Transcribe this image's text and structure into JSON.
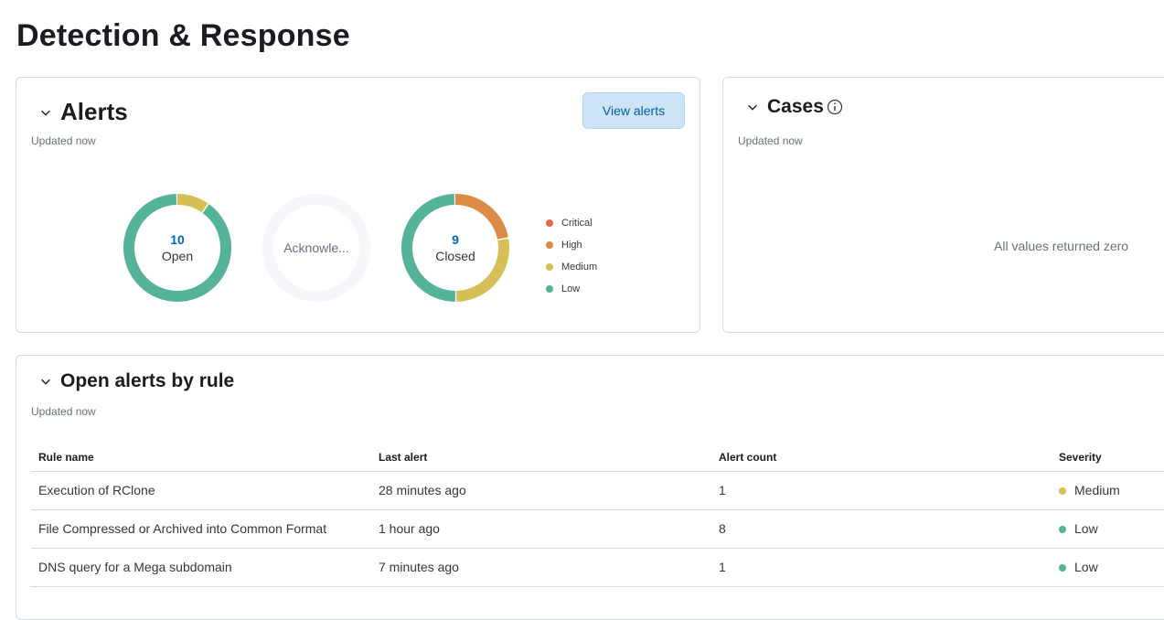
{
  "page": {
    "title": "Detection & Response"
  },
  "alerts_panel": {
    "title": "Alerts",
    "updated": "Updated now",
    "view_button": "View alerts",
    "donuts": [
      {
        "count": "10",
        "label": "Open",
        "segments": [
          {
            "severity": "low",
            "value": 9
          },
          {
            "severity": "medium",
            "value": 1
          }
        ]
      },
      {
        "count": "",
        "label": "Acknowle...",
        "segments": []
      },
      {
        "count": "9",
        "label": "Closed",
        "segments": [
          {
            "severity": "low",
            "value": 4.5
          },
          {
            "severity": "medium",
            "value": 2.5
          },
          {
            "severity": "high",
            "value": 2
          }
        ]
      }
    ],
    "legend": [
      {
        "label": "Critical",
        "color": "#e7664c"
      },
      {
        "label": "High",
        "color": "#da8b45"
      },
      {
        "label": "Medium",
        "color": "#d6bf57"
      },
      {
        "label": "Low",
        "color": "#54b399"
      }
    ]
  },
  "cases_panel": {
    "title": "Cases",
    "updated": "Updated now",
    "empty_message": "All values returned zero"
  },
  "rules_panel": {
    "title": "Open alerts by rule",
    "updated": "Updated now",
    "columns": [
      "Rule name",
      "Last alert",
      "Alert count",
      "Severity"
    ],
    "rows": [
      {
        "rule": "Execution of RClone",
        "last_alert": "28 minutes ago",
        "count": "1",
        "severity": "Medium",
        "severity_color": "#d6bf57"
      },
      {
        "rule": "File Compressed or Archived into Common Format",
        "last_alert": "1 hour ago",
        "count": "8",
        "severity": "Low",
        "severity_color": "#54b399"
      },
      {
        "rule": "DNS query for a Mega subdomain",
        "last_alert": "7 minutes ago",
        "count": "1",
        "severity": "Low",
        "severity_color": "#54b399"
      }
    ]
  },
  "colors": {
    "low": "#54b399",
    "medium": "#d6bf57",
    "high": "#da8b45",
    "critical": "#e7664c",
    "link": "#0061a6",
    "empty_ring": "#f5f7fa"
  },
  "icons": {
    "collapse": "chevron-down-icon",
    "info": "info-icon"
  }
}
